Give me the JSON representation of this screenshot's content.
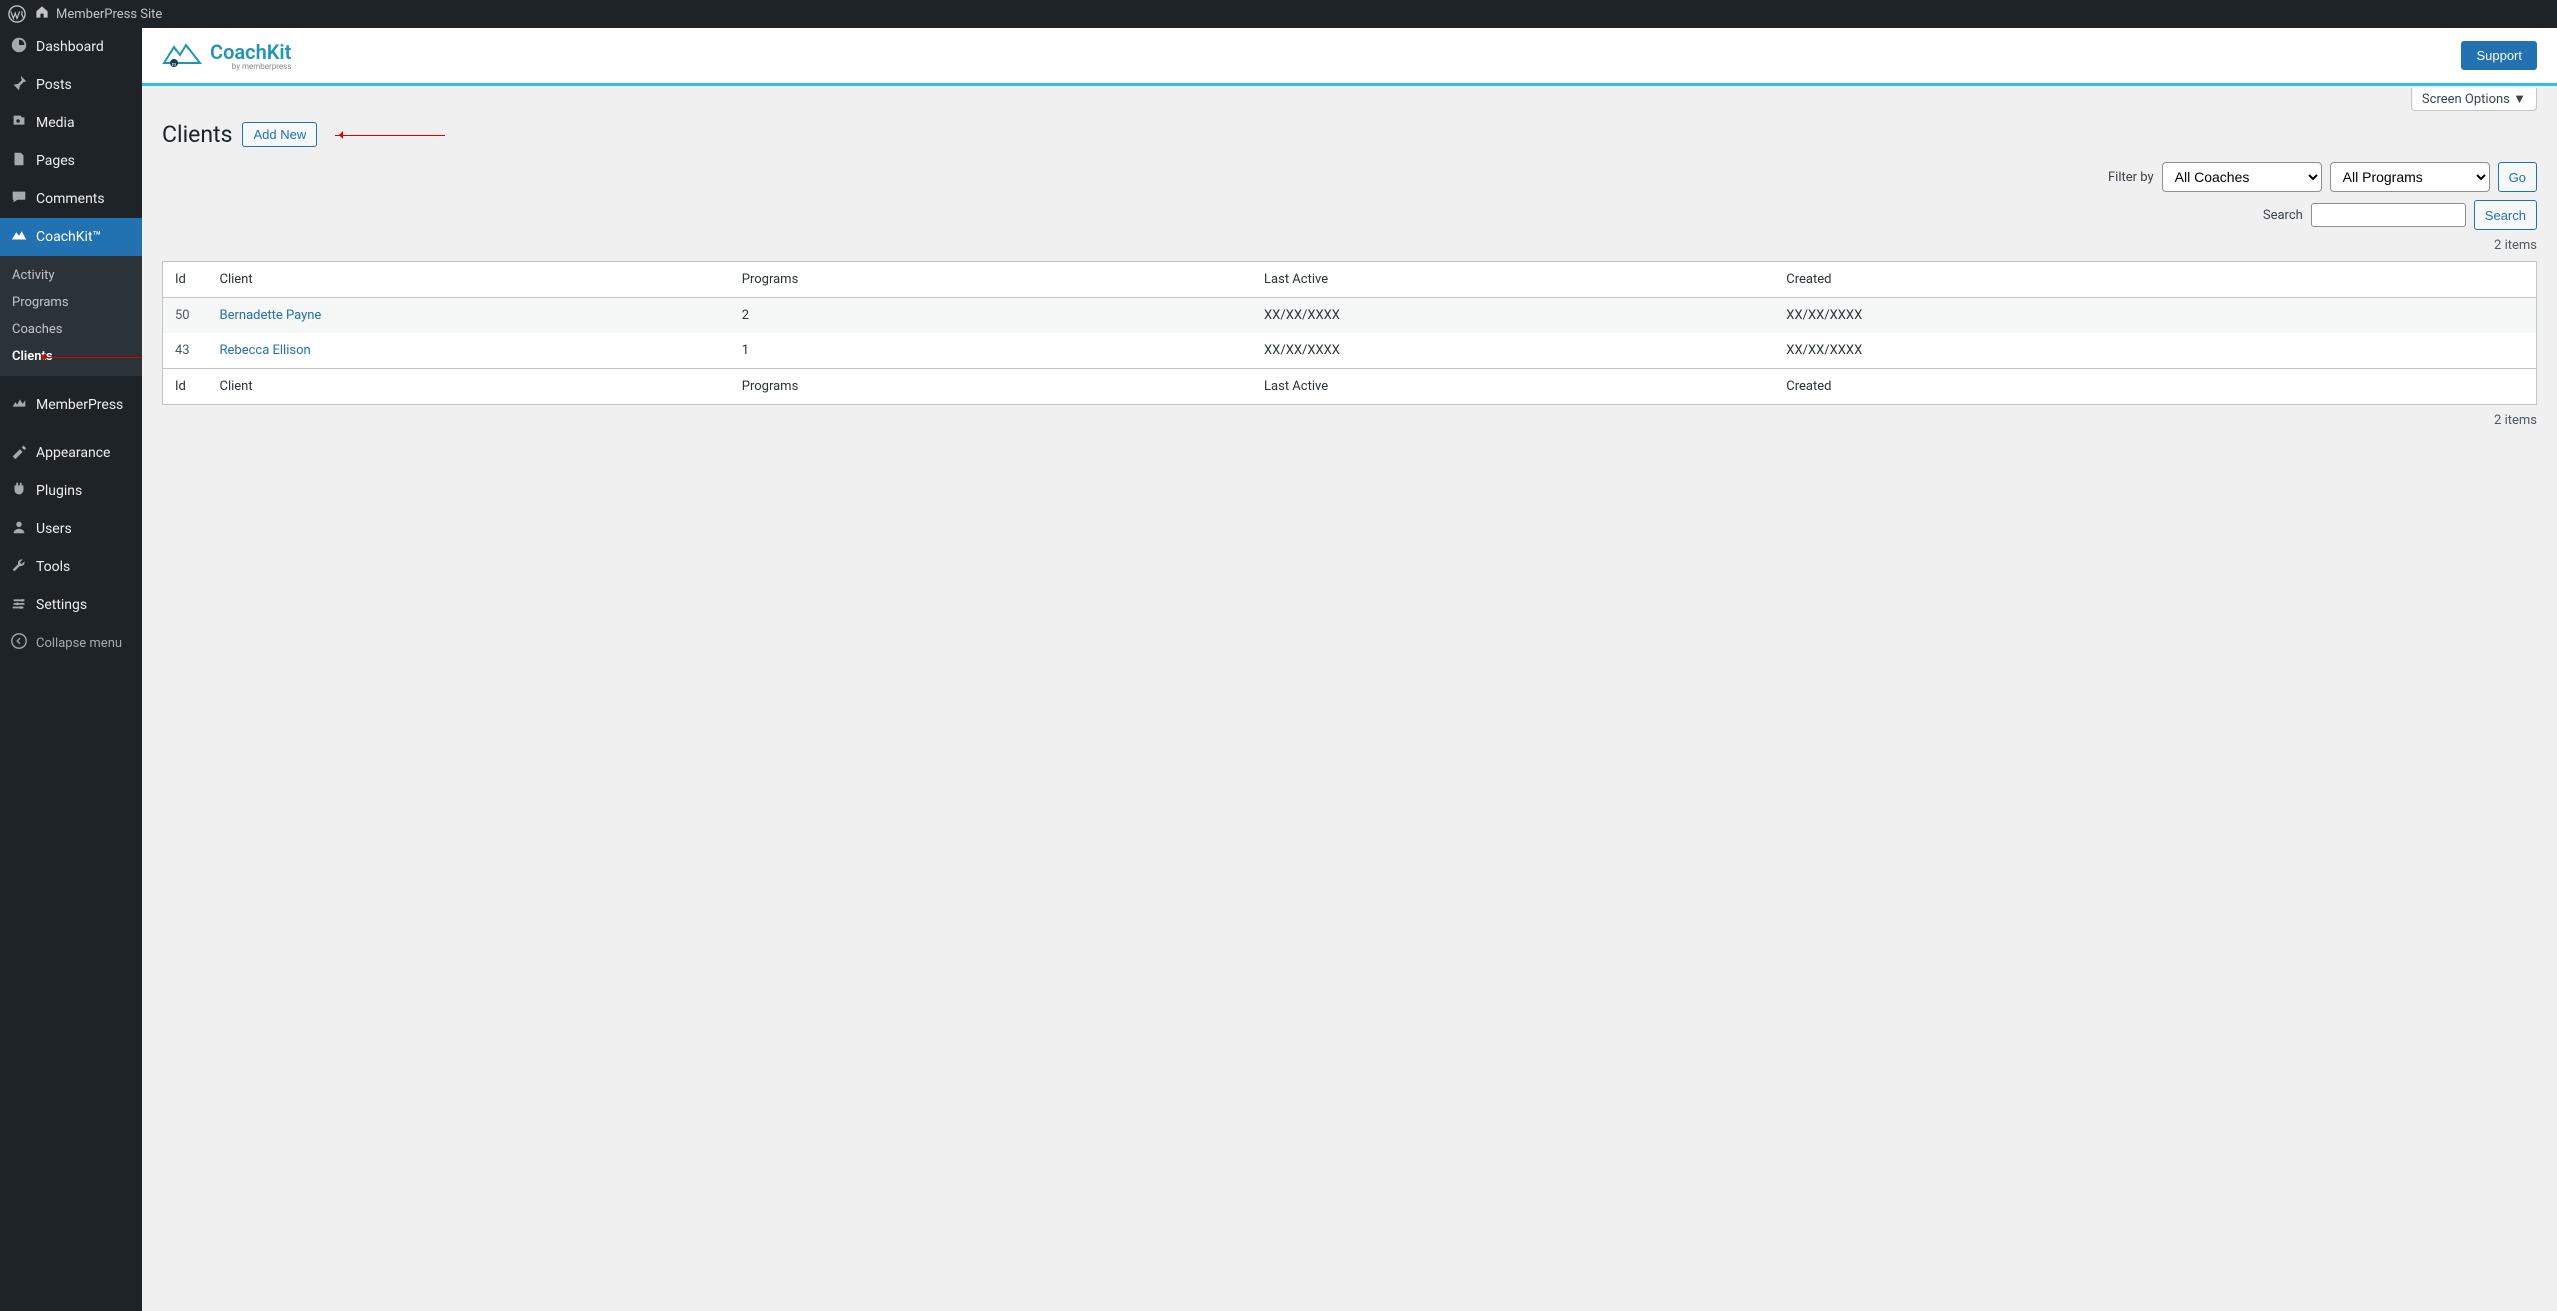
{
  "adminbar": {
    "site_name": "MemberPress Site"
  },
  "sidebar": {
    "items": [
      {
        "label": "Dashboard",
        "icon": "dashboard-icon"
      },
      {
        "label": "Posts",
        "icon": "pin-icon"
      },
      {
        "label": "Media",
        "icon": "media-icon"
      },
      {
        "label": "Pages",
        "icon": "page-icon"
      },
      {
        "label": "Comments",
        "icon": "comment-icon"
      },
      {
        "label": "CoachKit™",
        "icon": "coachkit-icon",
        "current": true
      },
      {
        "label": "MemberPress",
        "icon": "memberpress-icon"
      },
      {
        "label": "Appearance",
        "icon": "appearance-icon"
      },
      {
        "label": "Plugins",
        "icon": "plugin-icon"
      },
      {
        "label": "Users",
        "icon": "user-icon"
      },
      {
        "label": "Tools",
        "icon": "tools-icon"
      },
      {
        "label": "Settings",
        "icon": "settings-icon"
      }
    ],
    "submenu": [
      {
        "label": "Activity"
      },
      {
        "label": "Programs"
      },
      {
        "label": "Coaches"
      },
      {
        "label": "Clients",
        "current": true
      }
    ],
    "collapse_label": "Collapse menu"
  },
  "header": {
    "logo_text_1": "Coach",
    "logo_text_2": "Kit",
    "logo_sub": "by memberpress",
    "support_btn": "Support"
  },
  "screen_options_label": "Screen Options",
  "page": {
    "title": "Clients",
    "add_new": "Add New",
    "filter_by_label": "Filter by",
    "coaches_select": "All Coaches",
    "programs_select": "All Programs",
    "go_btn": "Go",
    "search_label": "Search",
    "search_btn": "Search",
    "items_count": "2 items"
  },
  "table": {
    "columns": {
      "id": "Id",
      "client": "Client",
      "programs": "Programs",
      "last_active": "Last Active",
      "created": "Created"
    },
    "rows": [
      {
        "id": "50",
        "client": "Bernadette Payne",
        "programs": "2",
        "last_active": "XX/XX/XXXX",
        "created": "XX/XX/XXXX"
      },
      {
        "id": "43",
        "client": "Rebecca Ellison",
        "programs": "1",
        "last_active": "XX/XX/XXXX",
        "created": "XX/XX/XXXX"
      }
    ]
  }
}
